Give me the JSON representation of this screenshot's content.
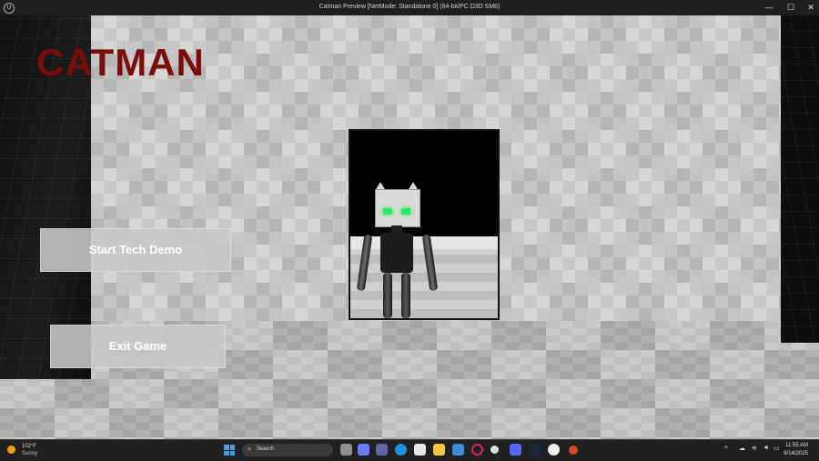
{
  "window": {
    "title": "Catman Preview [NetMode: Standalone 0]  (64-bit/PC D3D SM6)",
    "app_icon_label": "U",
    "minimize_glyph": "—",
    "maximize_glyph": "☐",
    "close_glyph": "✕"
  },
  "game": {
    "logo": "CATMAN",
    "logo_color": "#7a0c0c",
    "menu": {
      "start_label": "Start Tech Demo",
      "exit_label": "Exit Game"
    }
  },
  "taskbar": {
    "weather": {
      "temp": "102°F",
      "condition": "Sunny",
      "icon": "sun-icon"
    },
    "search_placeholder": "Search",
    "apps": [
      "file-explorer-icon",
      "edge-icon",
      "teams-icon",
      "store-icon",
      "folder-icon",
      "photos-icon",
      "opera-icon",
      "obs-icon",
      "discord-icon",
      "steam-icon",
      "unreal-icon",
      "game-icon"
    ],
    "tray": {
      "chevron": "^",
      "wifi": "wifi-icon",
      "volume": "volume-icon",
      "battery": "battery-icon"
    },
    "clock": {
      "time": "11:55 AM",
      "date": "6/14/2025"
    }
  }
}
